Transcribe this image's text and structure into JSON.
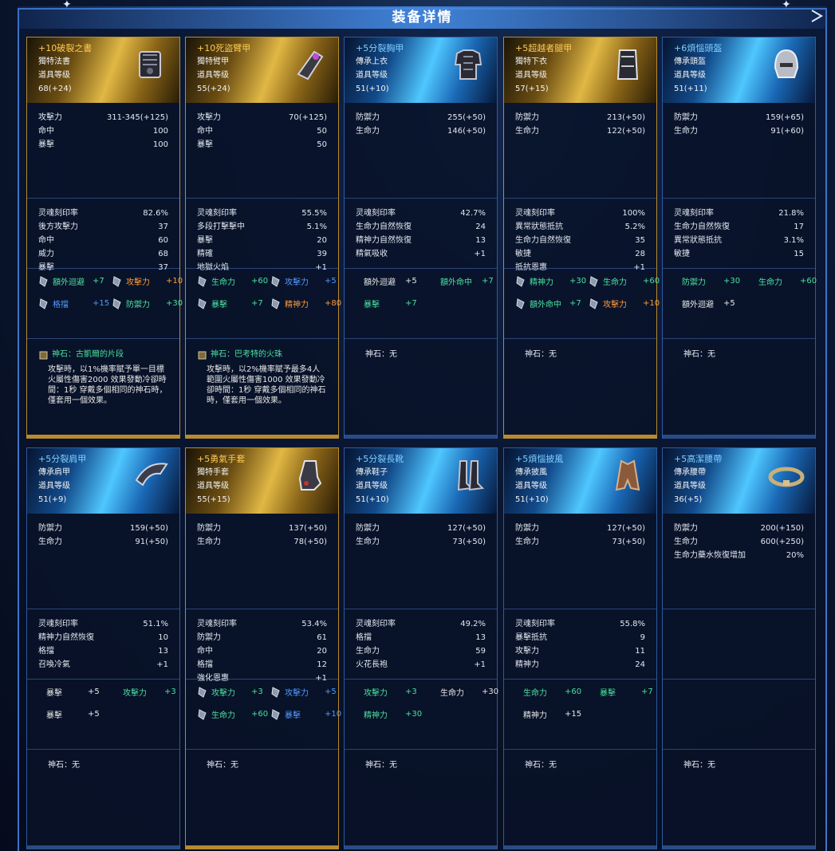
{
  "window": {
    "title": "装备详情"
  },
  "colors": {
    "gold": "#ffcc55",
    "blue_name": "#7fd0ff",
    "green": "#4be0a0",
    "orange": "#ff9a3c",
    "blue": "#4f9aff"
  },
  "cards": [
    {
      "tier": "gold",
      "icon": "book-icon",
      "name": "+10破裂之書",
      "type": "獨特法書",
      "level_label": "道具等级",
      "level": "68(+24)",
      "stats": [
        [
          "攻擊力",
          "311-345(+125)"
        ],
        [
          "命中",
          "100"
        ],
        [
          "暴擊",
          "100"
        ]
      ],
      "soul": [
        [
          "灵魂刻印率",
          "82.6%"
        ],
        [
          "後方攻擊力",
          "37"
        ],
        [
          "命中",
          "60"
        ],
        [
          "威力",
          "68"
        ],
        [
          "暴擊",
          "37"
        ]
      ],
      "gems": [
        [
          {
            "label": "額外迴避",
            "value": "+7",
            "color": "green",
            "icon": true
          },
          {
            "label": "攻擊力",
            "value": "+10",
            "color": "orange",
            "icon": true
          }
        ],
        [
          {
            "label": "格擋",
            "value": "+15",
            "color": "blue",
            "icon": true
          },
          {
            "label": "防禦力",
            "value": "+30",
            "color": "green",
            "icon": true
          }
        ]
      ],
      "stone_title": "神石：古凱爾的片段",
      "stone_desc": "攻擊時，以1%機率賦予單一目標火屬性傷害2000 效果發動冷卻時間：1秒 穿戴多個相同的神石時，僅套用一個效果。"
    },
    {
      "tier": "gold",
      "icon": "bracer-icon",
      "name": "+10死盜臂甲",
      "type": "獨特臂甲",
      "level_label": "道具等级",
      "level": "55(+24)",
      "stats": [
        [
          "攻擊力",
          "70(+125)"
        ],
        [
          "命中",
          "50"
        ],
        [
          "暴擊",
          "50"
        ]
      ],
      "soul": [
        [
          "灵魂刻印率",
          "55.5%"
        ],
        [
          "多段打擊擊中",
          "5.1%"
        ],
        [
          "暴擊",
          "20"
        ],
        [
          "精確",
          "39"
        ],
        [
          "地獄火焰",
          "+1"
        ]
      ],
      "gems": [
        [
          {
            "label": "生命力",
            "value": "+60",
            "color": "green",
            "icon": true
          },
          {
            "label": "攻擊力",
            "value": "+5",
            "color": "blue",
            "icon": true
          }
        ],
        [
          {
            "label": "暴擊",
            "value": "+7",
            "color": "green",
            "icon": true
          },
          {
            "label": "精神力",
            "value": "+80",
            "color": "orange",
            "icon": true
          }
        ]
      ],
      "stone_title": "神石：巴考特的火珠",
      "stone_desc": "攻擊時，以2%機率賦予最多4人範圍火屬性傷害1000 效果發動冷卻時間：1秒 穿戴多個相同的神石時，僅套用一個效果。"
    },
    {
      "tier": "blue",
      "icon": "chest-armor-icon",
      "name": "+5分裂胸甲",
      "type": "傳承上衣",
      "level_label": "道具等级",
      "level": "51(+10)",
      "stats": [
        [
          "防禦力",
          "255(+50)"
        ],
        [
          "生命力",
          "146(+50)"
        ]
      ],
      "soul": [
        [
          "灵魂刻印率",
          "42.7%"
        ],
        [
          "生命力自然恢復",
          "24"
        ],
        [
          "精神力自然恢復",
          "13"
        ],
        [
          "精氣吸收",
          "+1"
        ]
      ],
      "gems": [
        [
          {
            "label": "額外迴避",
            "value": "+5",
            "color": "white",
            "icon": false
          },
          {
            "label": "額外命中",
            "value": "+7",
            "color": "green",
            "icon": false
          }
        ],
        [
          {
            "label": "暴擊",
            "value": "+7",
            "color": "green",
            "icon": false
          }
        ]
      ],
      "stone_title": "神石：无",
      "stone_desc": ""
    },
    {
      "tier": "gold",
      "icon": "greaves-icon",
      "name": "+5超越者腿甲",
      "type": "獨特下衣",
      "level_label": "道具等级",
      "level": "57(+15)",
      "stats": [
        [
          "防禦力",
          "213(+50)"
        ],
        [
          "生命力",
          "122(+50)"
        ]
      ],
      "soul": [
        [
          "灵魂刻印率",
          "100%"
        ],
        [
          "異常狀態抵抗",
          "5.2%"
        ],
        [
          "生命力自然恢復",
          "35"
        ],
        [
          "敏捷",
          "28"
        ],
        [
          "抵抗恩惠",
          "+1"
        ]
      ],
      "gems": [
        [
          {
            "label": "精神力",
            "value": "+30",
            "color": "green",
            "icon": true
          },
          {
            "label": "生命力",
            "value": "+60",
            "color": "green",
            "icon": true
          }
        ],
        [
          {
            "label": "額外命中",
            "value": "+7",
            "color": "green",
            "icon": true
          },
          {
            "label": "攻擊力",
            "value": "+10",
            "color": "orange",
            "icon": true
          }
        ]
      ],
      "stone_title": "神石：无",
      "stone_desc": ""
    },
    {
      "tier": "blue",
      "icon": "helmet-icon",
      "name": "+6煩惱頭盔",
      "type": "傳承頭盔",
      "level_label": "道具等级",
      "level": "51(+11)",
      "stats": [
        [
          "防禦力",
          "159(+65)"
        ],
        [
          "生命力",
          "91(+60)"
        ]
      ],
      "soul": [
        [
          "灵魂刻印率",
          "21.8%"
        ],
        [
          "生命力自然恢復",
          "17"
        ],
        [
          "異常狀態抵抗",
          "3.1%"
        ],
        [
          "敏捷",
          "15"
        ]
      ],
      "gems": [
        [
          {
            "label": "防禦力",
            "value": "+30",
            "color": "green",
            "icon": false
          },
          {
            "label": "生命力",
            "value": "+60",
            "color": "green",
            "icon": false
          }
        ],
        [
          {
            "label": "額外迴避",
            "value": "+5",
            "color": "white",
            "icon": false
          }
        ]
      ],
      "stone_title": "神石：无",
      "stone_desc": ""
    },
    {
      "tier": "blue",
      "icon": "shoulder-icon",
      "name": "+5分裂肩甲",
      "type": "傳承肩甲",
      "level_label": "道具等级",
      "level": "51(+9)",
      "stats": [
        [
          "防禦力",
          "159(+50)"
        ],
        [
          "生命力",
          "91(+50)"
        ]
      ],
      "soul": [
        [
          "灵魂刻印率",
          "51.1%"
        ],
        [
          "精神力自然恢復",
          "10"
        ],
        [
          "格擋",
          "13"
        ],
        [
          "召喚冷氣",
          "+1"
        ]
      ],
      "gems": [
        [
          {
            "label": "暴擊",
            "value": "+5",
            "color": "white",
            "icon": false
          },
          {
            "label": "攻擊力",
            "value": "+3",
            "color": "green",
            "icon": false
          }
        ],
        [
          {
            "label": "暴擊",
            "value": "+5",
            "color": "white",
            "icon": false
          }
        ]
      ],
      "stone_title": "神石：无",
      "stone_desc": ""
    },
    {
      "tier": "gold",
      "icon": "gauntlet-icon",
      "name": "+5勇氣手套",
      "type": "獨特手套",
      "level_label": "道具等级",
      "level": "55(+15)",
      "stats": [
        [
          "防禦力",
          "137(+50)"
        ],
        [
          "生命力",
          "78(+50)"
        ]
      ],
      "soul": [
        [
          "灵魂刻印率",
          "53.4%"
        ],
        [
          "防禦力",
          "61"
        ],
        [
          "命中",
          "20"
        ],
        [
          "格擋",
          "12"
        ],
        [
          "強化恩惠",
          "+1"
        ]
      ],
      "gems": [
        [
          {
            "label": "攻擊力",
            "value": "+3",
            "color": "green",
            "icon": true
          },
          {
            "label": "攻擊力",
            "value": "+5",
            "color": "blue",
            "icon": true
          }
        ],
        [
          {
            "label": "生命力",
            "value": "+60",
            "color": "green",
            "icon": true
          },
          {
            "label": "暴擊",
            "value": "+10",
            "color": "blue",
            "icon": true
          }
        ]
      ],
      "stone_title": "神石：无",
      "stone_desc": ""
    },
    {
      "tier": "blue",
      "icon": "boots-icon",
      "name": "+5分裂長靴",
      "type": "傳承鞋子",
      "level_label": "道具等级",
      "level": "51(+10)",
      "stats": [
        [
          "防禦力",
          "127(+50)"
        ],
        [
          "生命力",
          "73(+50)"
        ]
      ],
      "soul": [
        [
          "灵魂刻印率",
          "49.2%"
        ],
        [
          "格擋",
          "13"
        ],
        [
          "生命力",
          "59"
        ],
        [
          "火花長袍",
          "+1"
        ]
      ],
      "gems": [
        [
          {
            "label": "攻擊力",
            "value": "+3",
            "color": "green",
            "icon": false
          },
          {
            "label": "生命力",
            "value": "+30",
            "color": "white",
            "icon": false
          }
        ],
        [
          {
            "label": "精神力",
            "value": "+30",
            "color": "green",
            "icon": false
          }
        ]
      ],
      "stone_title": "神石：无",
      "stone_desc": ""
    },
    {
      "tier": "blue",
      "icon": "cape-icon",
      "name": "+5煩惱披風",
      "type": "傳承披風",
      "level_label": "道具等级",
      "level": "51(+10)",
      "stats": [
        [
          "防禦力",
          "127(+50)"
        ],
        [
          "生命力",
          "73(+50)"
        ]
      ],
      "soul": [
        [
          "灵魂刻印率",
          "55.8%"
        ],
        [
          "暴擊抵抗",
          "9"
        ],
        [
          "攻擊力",
          "11"
        ],
        [
          "精神力",
          "24"
        ]
      ],
      "gems": [
        [
          {
            "label": "生命力",
            "value": "+60",
            "color": "green",
            "icon": false
          },
          {
            "label": "暴擊",
            "value": "+7",
            "color": "green",
            "icon": false
          }
        ],
        [
          {
            "label": "精神力",
            "value": "+15",
            "color": "white",
            "icon": false
          }
        ]
      ],
      "stone_title": "神石：无",
      "stone_desc": ""
    },
    {
      "tier": "blue",
      "icon": "belt-icon",
      "name": "+5高潔腰帶",
      "type": "傳承腰帶",
      "level_label": "道具等级",
      "level": "36(+5)",
      "stats": [
        [
          "防禦力",
          "200(+150)"
        ],
        [
          "生命力",
          "600(+250)"
        ],
        [
          "生命力藥水恢復增加",
          "20%"
        ]
      ],
      "soul": [],
      "gems": [],
      "stone_title": "神石：无",
      "stone_desc": ""
    }
  ]
}
